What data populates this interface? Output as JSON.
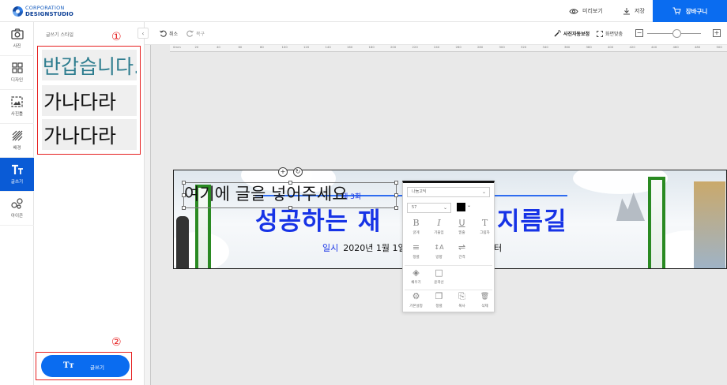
{
  "header": {
    "logo_line1": "CORPORATION",
    "logo_line2": "DESIGNSTUDIO",
    "preview_label": "미리보기",
    "save_label": "저장",
    "cart_label": "장바구니",
    "accent_color": "#0a6cf0"
  },
  "sidebar": {
    "items": [
      {
        "label": "사진",
        "icon": "camera-icon"
      },
      {
        "label": "디자인",
        "icon": "layout-grid-icon"
      },
      {
        "label": "사진틀",
        "icon": "image-frame-icon"
      },
      {
        "label": "배경",
        "icon": "hatch-pattern-icon"
      },
      {
        "label": "글쓰기",
        "icon": "text-tt-icon"
      },
      {
        "label": "아이콘",
        "icon": "shapes-icon"
      }
    ],
    "active": "글쓰기"
  },
  "panel": {
    "title": "글쓰기 스타일",
    "marker1": "①",
    "marker2": "②",
    "styles": [
      {
        "text": "반갑습니다.",
        "color": "#2e7d8f"
      },
      {
        "text": "가나다라",
        "color": "#111111"
      },
      {
        "text": "가나다라",
        "color": "#111111"
      }
    ],
    "write_button": {
      "icon": "Tт",
      "label": "글쓰기"
    }
  },
  "toolbar": {
    "undo_label": "취소",
    "redo_label": "복구",
    "autofit_label": "사진자동보정",
    "fullscreen_label": "화면맞춤"
  },
  "ruler": [
    "0mm",
    "20",
    "40",
    "60",
    "80",
    "100",
    "120",
    "140",
    "160",
    "180",
    "200",
    "220",
    "240",
    "260",
    "280",
    "300",
    "320",
    "340",
    "360",
    "380",
    "400",
    "420",
    "440",
    "460",
    "480",
    "500"
  ],
  "canvas": {
    "placeholder_text": "여기에 글을 넣어주세요",
    "small_text": "제 3회",
    "title_left": "성공하는 재",
    "title_right": "지름길",
    "sub_label": "일시",
    "sub_text": "2020년 1월 1일",
    "sub_tail": "터",
    "title_color": "#1733e6"
  },
  "context_menu": {
    "font_name": "나눔고딕",
    "font_size": "57",
    "text_color": "#000000",
    "row1": [
      {
        "icon": "B",
        "label": "굵게"
      },
      {
        "icon": "I",
        "label": "기울임"
      },
      {
        "icon": "U",
        "label": "밑줄"
      },
      {
        "icon": "T",
        "label": "그림자"
      }
    ],
    "row2": [
      {
        "icon": "≡",
        "label": "정렬"
      },
      {
        "icon": "↕A",
        "label": "방향"
      },
      {
        "icon": "⇌",
        "label": "간격"
      }
    ],
    "row3": [
      {
        "icon": "◈",
        "label": "채우기"
      },
      {
        "icon": "□",
        "label": "윤곽선"
      }
    ],
    "row4": [
      {
        "icon": "⚙",
        "label": "기본설정"
      },
      {
        "icon": "❐",
        "label": "정렬"
      },
      {
        "icon": "⎘",
        "label": "복사"
      },
      {
        "icon": "🗑",
        "label": "삭제"
      }
    ]
  }
}
